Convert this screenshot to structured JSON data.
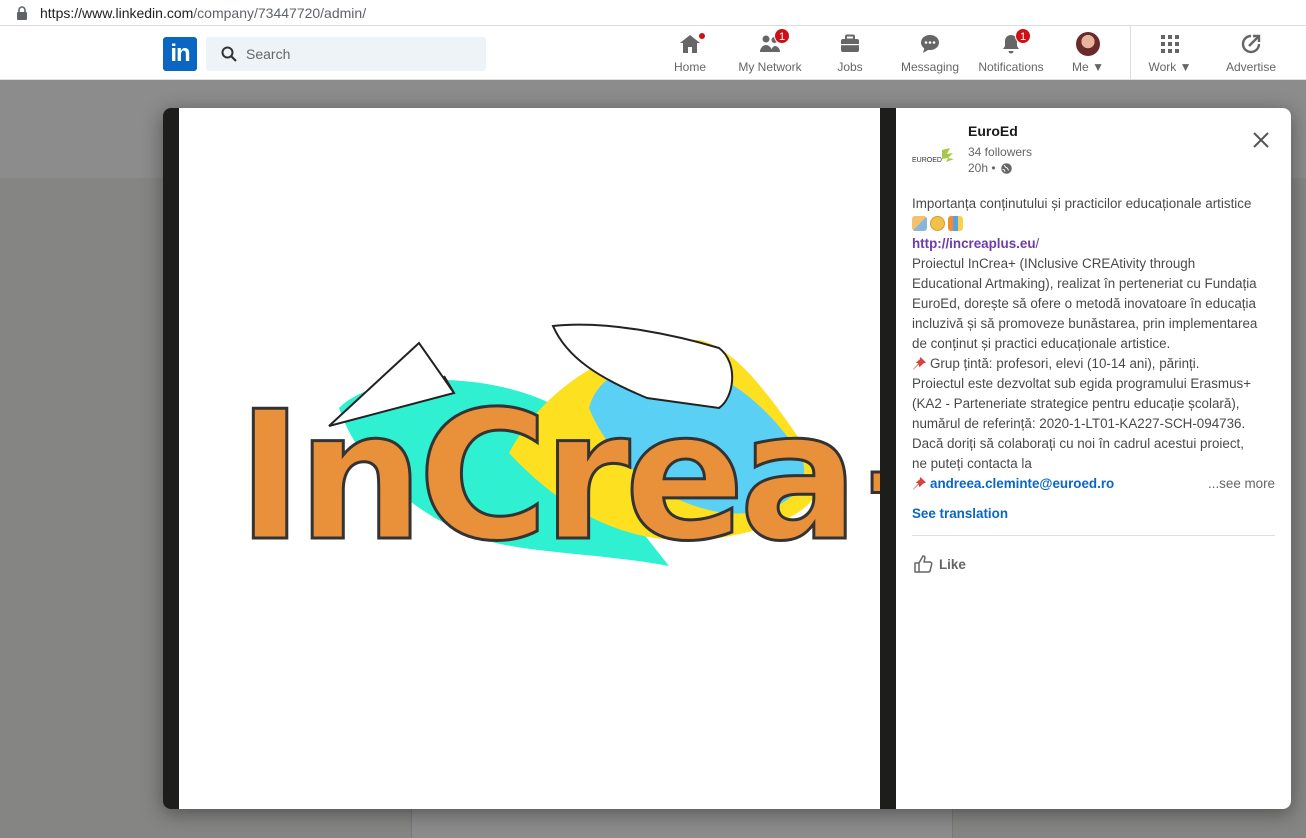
{
  "browser": {
    "url_host": "https://www.linkedin.com",
    "url_path": "/company/73447720/admin/"
  },
  "header": {
    "search_placeholder": "Search",
    "nav": [
      {
        "label": "Home",
        "icon": "home-icon"
      },
      {
        "label": "My Network",
        "icon": "network-icon",
        "badge": "1"
      },
      {
        "label": "Jobs",
        "icon": "briefcase-icon"
      },
      {
        "label": "Messaging",
        "icon": "chat-icon"
      },
      {
        "label": "Notifications",
        "icon": "bell-icon",
        "badge": "1"
      },
      {
        "label": "Me",
        "icon": "avatar"
      },
      {
        "label": "Work",
        "icon": "grid-icon"
      },
      {
        "label": "Advertise",
        "icon": "compass-icon"
      }
    ]
  },
  "post": {
    "company": "EuroEd",
    "followers": "34 followers",
    "time": "20h •",
    "lines": [
      "Importanța conținutului și practicilor educaționale artistice",
      "",
      "",
      "Proiectul InCrea+ (INclusive CREAtivity through",
      "Educational Artmaking), realizat în perteneriat cu Fundația",
      "EuroEd, dorește să ofere o metodă inovatoare în educația",
      "incluzivă și să promoveze bunăstarea, prin implementarea",
      "de conținut și practici educaționale artistice.",
      "Grup țintă: profesori, elevi (10-14 ani), părinți.",
      "Proiectul este dezvoltat sub egida programului Erasmus+",
      "(KA2 - Parteneriate strategice pentru educație școlară),",
      "numărul de referință: 2020-1-LT01-KA227-SCH-094736.",
      "Dacă doriți să colaborați cu noi în cadrul acestui proiect,",
      "ne puteți contacta la"
    ],
    "link": "http://increaplus.eu",
    "link_suffix": "/",
    "email": "andreea.cleminte@euroed.ro",
    "see_more": "...see more",
    "see_translation": "See translation",
    "like": "Like",
    "image_text": "InCrea+"
  },
  "colors": {
    "linkedin_blue": "#0a66c2",
    "badge_red": "#cc1016",
    "logo_orange": "#e8913a",
    "logo_yellow": "#fde020",
    "logo_teal": "#2ff0d0",
    "logo_skyblue": "#5bd0f5",
    "link_purple": "#6e3ca8"
  }
}
